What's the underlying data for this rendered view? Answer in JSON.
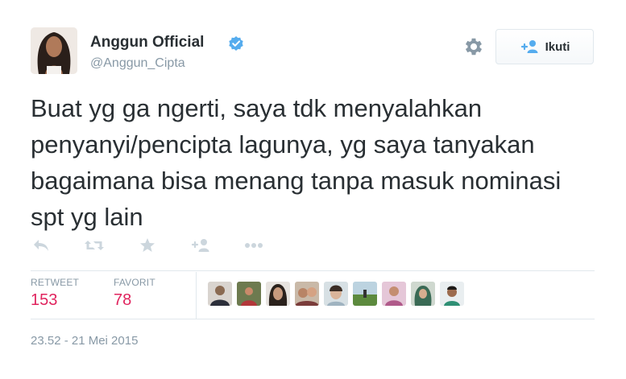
{
  "user": {
    "name": "Anggun Official",
    "handle": "@Anggun_Cipta"
  },
  "follow_button": {
    "label": "Ikuti",
    "icon": "add-person-icon"
  },
  "tweet": {
    "text": "Buat yg ga ngerti, saya tdk menyalahkan penyanyi/pencipta lagunya, yg saya tanyakan bagaimana bisa menang tanpa masuk nominasi spt yg lain"
  },
  "actions": [
    "reply-icon",
    "retweet-icon",
    "favorite-icon",
    "follow-icon",
    "more-icon"
  ],
  "stats": {
    "retweet_label": "RETWEET",
    "retweet_count": "153",
    "favorite_label": "FAVORIT",
    "favorite_count": "78"
  },
  "timestamp": "23.52 - 21 Mei 2015",
  "colors": {
    "text": "#292f33",
    "muted": "#8899a6",
    "count": "#e0245e",
    "verified": "#55acee",
    "icon": "#ccd6dd",
    "border": "#e1e8ed"
  }
}
